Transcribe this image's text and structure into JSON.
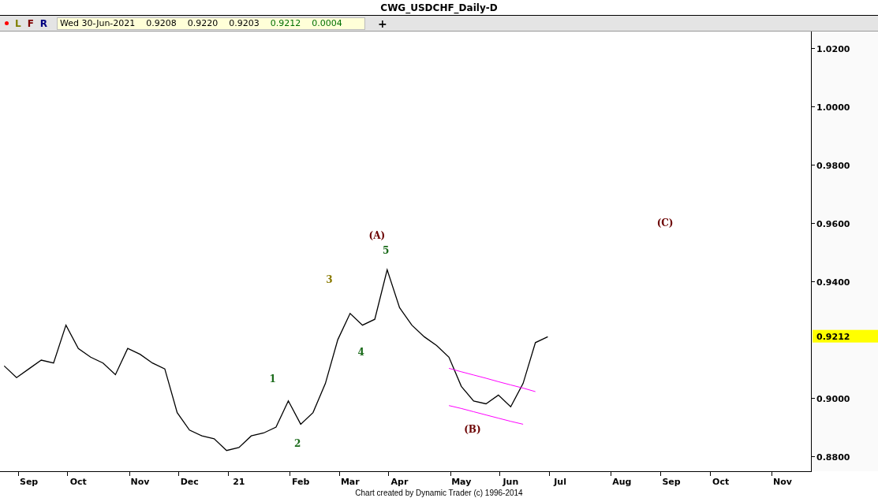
{
  "window": {
    "title": "CWG_USDCHF_Daily-D"
  },
  "toolbar": {
    "buttons": [
      {
        "kind": "dot",
        "color": "#ff0000"
      },
      {
        "kind": "letter",
        "label": "L",
        "color": "#808000"
      },
      {
        "kind": "letter",
        "label": "F",
        "color": "#800000"
      },
      {
        "kind": "letter",
        "label": "R",
        "color": "#000080"
      }
    ],
    "quote": [
      {
        "text": "Wed 30-Jun-2021",
        "color": "#000000"
      },
      {
        "text": "0.9208",
        "color": "#000000"
      },
      {
        "text": "0.9220",
        "color": "#000000"
      },
      {
        "text": "0.9203",
        "color": "#000000"
      },
      {
        "text": "0.9212",
        "color": "#007000"
      },
      {
        "text": "0.0004",
        "color": "#007000"
      }
    ],
    "add_button": "+"
  },
  "chart": {
    "chart_data": {
      "type": "line",
      "ylim": [
        0.8749,
        1.0257
      ],
      "categories": [
        null,
        null,
        "Sep",
        null,
        null,
        null,
        "Oct",
        null,
        null,
        null,
        null,
        "Nov",
        null,
        null,
        null,
        "Dec",
        null,
        null,
        null,
        "21",
        null,
        null,
        null,
        null,
        "Feb",
        null,
        null,
        null,
        "Mar",
        null,
        null,
        null,
        "Apr",
        null,
        null,
        null,
        null,
        "May",
        null,
        null,
        null,
        "Jun",
        null,
        null,
        null,
        "Jul",
        null,
        null,
        null,
        null,
        "Aug",
        null,
        null,
        null,
        "Sep",
        null,
        null,
        null,
        "Oct",
        null,
        null,
        null,
        null,
        "Nov",
        null,
        null
      ],
      "series": [
        {
          "color": "#000000",
          "values": [
            0.911,
            0.907,
            0.91,
            0.913,
            0.912,
            0.925,
            0.917,
            0.914,
            0.912,
            0.908,
            0.917,
            0.915,
            0.912,
            0.91,
            0.895,
            0.889,
            0.887,
            0.886,
            0.882,
            0.883,
            0.887,
            0.888,
            0.89,
            0.899,
            0.891,
            0.895,
            0.905,
            0.92,
            0.929,
            0.925,
            0.927,
            0.944,
            0.931,
            0.925,
            0.921,
            0.918,
            0.914,
            0.904,
            0.899,
            0.898,
            0.901,
            0.897,
            0.905,
            0.919,
            0.921,
            null,
            null,
            null,
            null,
            null,
            null,
            null,
            null,
            null,
            null,
            null,
            null,
            null,
            null,
            null,
            null,
            null,
            null,
            null,
            null,
            null
          ]
        },
        {
          "color": "#ff00ff",
          "values": [
            null,
            null,
            null,
            null,
            null,
            null,
            null,
            null,
            null,
            null,
            null,
            null,
            null,
            null,
            null,
            null,
            null,
            null,
            null,
            null,
            null,
            null,
            null,
            null,
            null,
            null,
            null,
            null,
            null,
            null,
            null,
            null,
            null,
            null,
            null,
            null,
            0.9102,
            0.909,
            0.9079,
            0.9068,
            0.9056,
            0.9045,
            0.9034,
            0.9022,
            null,
            null,
            null,
            null,
            null,
            null,
            null,
            null,
            null,
            null,
            null,
            null,
            null,
            null,
            null,
            null,
            null,
            null,
            null,
            null,
            null,
            null
          ]
        },
        {
          "color": "#ff00ff",
          "values": [
            null,
            null,
            null,
            null,
            null,
            null,
            null,
            null,
            null,
            null,
            null,
            null,
            null,
            null,
            null,
            null,
            null,
            null,
            null,
            null,
            null,
            null,
            null,
            null,
            null,
            null,
            null,
            null,
            null,
            null,
            null,
            null,
            null,
            null,
            null,
            null,
            0.8974,
            0.8964,
            0.8953,
            0.8942,
            0.8931,
            0.892,
            0.891,
            null,
            null,
            null,
            null,
            null,
            null,
            null,
            null,
            null,
            null,
            null,
            null,
            null,
            null,
            null,
            null,
            null,
            null,
            null,
            null,
            null,
            null,
            null
          ]
        }
      ],
      "yticks": [
        {
          "value": 1.02,
          "label": "1.0200"
        },
        {
          "value": 1.0,
          "label": "1.0000"
        },
        {
          "value": 0.98,
          "label": "0.9800"
        },
        {
          "value": 0.96,
          "label": "0.9600"
        },
        {
          "value": 0.94,
          "label": "0.9400"
        },
        {
          "value": 0.9,
          "label": "0.9000"
        },
        {
          "value": 0.88,
          "label": "0.8800"
        }
      ]
    },
    "wave_labels": [
      {
        "text": "(A)",
        "color": "#6b0000"
      },
      {
        "text": "5",
        "color": "#1b6b1b"
      },
      {
        "text": "3",
        "color": "#8a7a00"
      },
      {
        "text": "4",
        "color": "#1b6b1b"
      },
      {
        "text": "1",
        "color": "#1b6b1b"
      },
      {
        "text": "2",
        "color": "#1b6b1b"
      },
      {
        "text": "(B)",
        "color": "#6b0000"
      },
      {
        "text": "(C)",
        "color": "#6b0000"
      }
    ],
    "last_price": "0.9212"
  },
  "footer": "Chart created by Dynamic Trader  (c) 1996-2014"
}
